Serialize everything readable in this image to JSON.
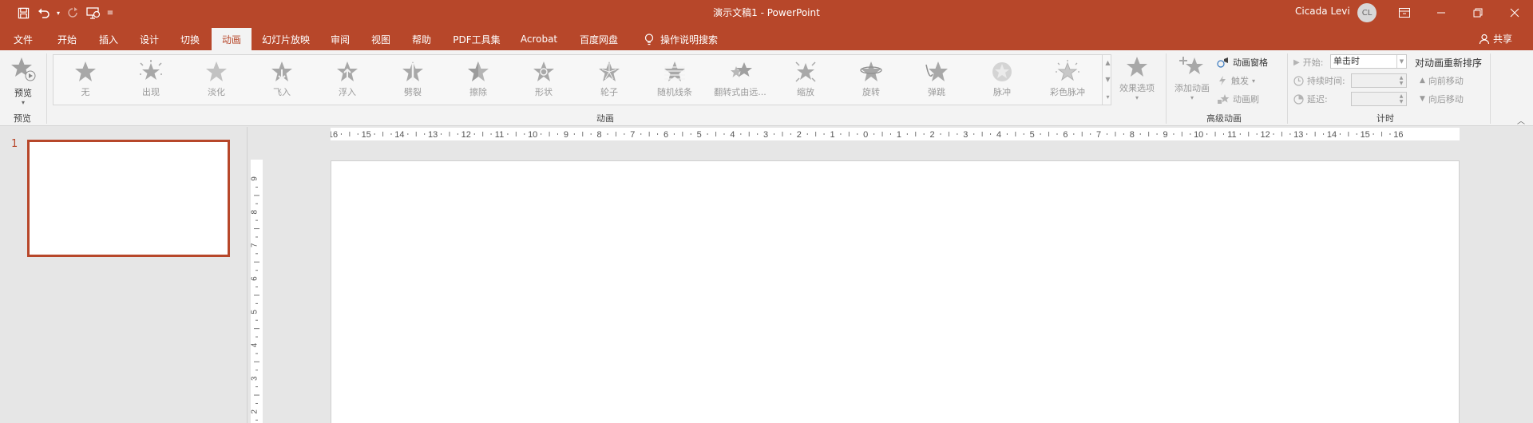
{
  "titlebar": {
    "document_title": "演示文稿1  -  PowerPoint",
    "user_name": "Cicada Levi",
    "avatar_initials": "CL",
    "accent_color": "#b7472a"
  },
  "quick_access": {
    "save_icon": "save-icon",
    "undo_icon": "undo-icon",
    "redo_icon": "redo-icon",
    "start_from_beginning_icon": "slideshow-from-start-icon",
    "customize_icon": "customize-qat-icon"
  },
  "tabs": [
    {
      "label": "文件"
    },
    {
      "label": "开始"
    },
    {
      "label": "插入"
    },
    {
      "label": "设计"
    },
    {
      "label": "切换"
    },
    {
      "label": "动画",
      "active": true
    },
    {
      "label": "幻灯片放映"
    },
    {
      "label": "审阅"
    },
    {
      "label": "视图"
    },
    {
      "label": "帮助"
    },
    {
      "label": "PDF工具集"
    },
    {
      "label": "Acrobat"
    },
    {
      "label": "百度网盘"
    },
    {
      "label": "操作说明搜索"
    }
  ],
  "share_label": "共享",
  "ribbon": {
    "preview": {
      "label": "预览",
      "group": "预览"
    },
    "animations": [
      {
        "label": "无"
      },
      {
        "label": "出现"
      },
      {
        "label": "淡化"
      },
      {
        "label": "飞入"
      },
      {
        "label": "浮入"
      },
      {
        "label": "劈裂"
      },
      {
        "label": "擦除"
      },
      {
        "label": "形状"
      },
      {
        "label": "轮子"
      },
      {
        "label": "随机线条"
      },
      {
        "label": "翻转式由远..."
      },
      {
        "label": "缩放"
      },
      {
        "label": "旋转"
      },
      {
        "label": "弹跳"
      },
      {
        "label": "脉冲"
      },
      {
        "label": "彩色脉冲"
      }
    ],
    "effect_options": "效果选项",
    "group_animation": "动画",
    "advanced": {
      "add_animation": "添加动画",
      "animation_pane": "动画窗格",
      "trigger": "触发",
      "animation_painter": "动画刷",
      "group": "高级动画"
    },
    "timing": {
      "start_label": "开始:",
      "start_value": "单击时",
      "duration_label": "持续时间:",
      "delay_label": "延迟:",
      "reorder_title": "对动画重新排序",
      "move_earlier": "向前移动",
      "move_later": "向后移动",
      "group": "计时"
    }
  },
  "slides": [
    {
      "number": "1"
    }
  ],
  "rulers": {
    "horizontal_ticks": [
      "16",
      "15",
      "14",
      "13",
      "12",
      "11",
      "10",
      "9",
      "8",
      "7",
      "6",
      "5",
      "4",
      "3",
      "2",
      "1",
      "0",
      "1",
      "2",
      "3",
      "4",
      "5",
      "6",
      "7",
      "8",
      "9",
      "10",
      "11",
      "12",
      "13",
      "14",
      "15",
      "16"
    ],
    "vertical_ticks": [
      "9",
      "8",
      "7",
      "6",
      "5",
      "4",
      "3",
      "2"
    ]
  }
}
